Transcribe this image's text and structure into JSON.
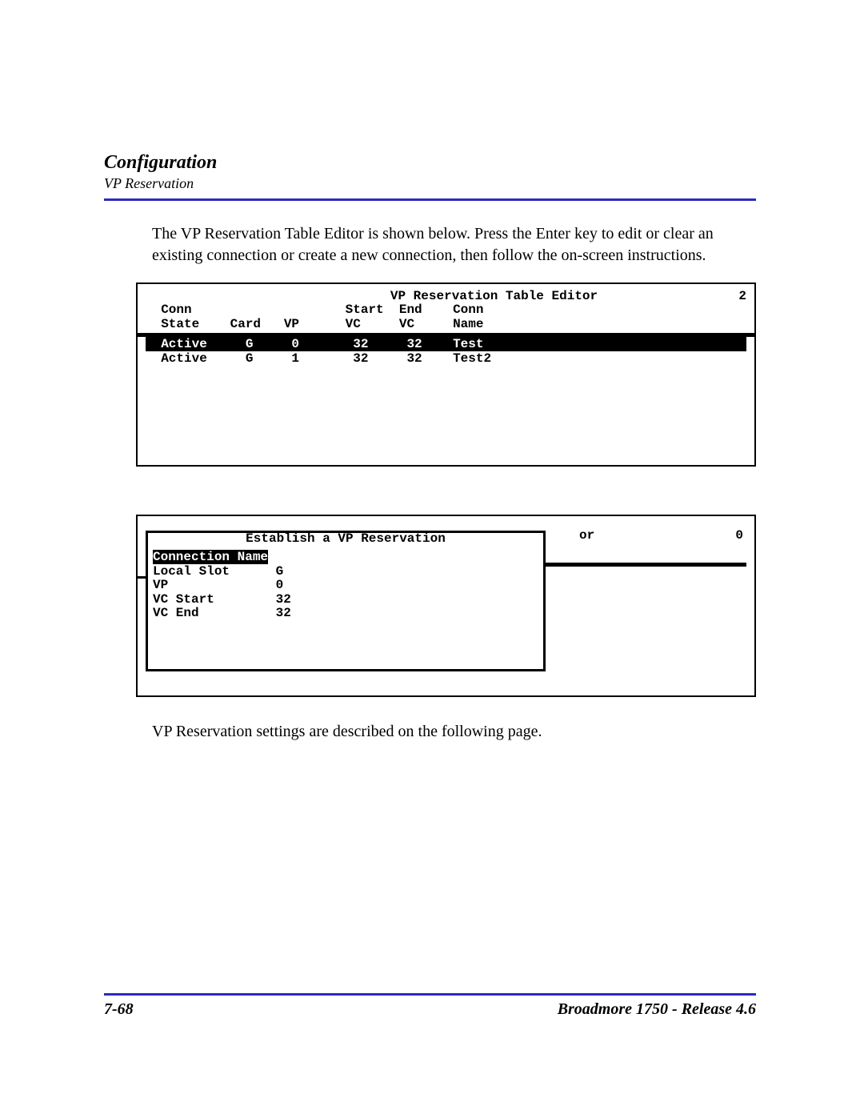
{
  "header": {
    "chapter": "Configuration",
    "section": "VP Reservation"
  },
  "paragraphs": {
    "intro": "The VP Reservation Table Editor is shown below. Press the Enter key to edit or clear an existing connection or create a new connection, then follow the on-screen instructions.",
    "outro": "VP Reservation settings are described on the following page."
  },
  "terminal1": {
    "title": "VP Reservation Table Editor",
    "count": "2",
    "col_header_line1": "  Conn                    Start  End    Conn",
    "col_header_line2": "  State    Card   VP      VC     VC     Name",
    "rows": [
      "  Active     G     0       32     32    Test                       ",
      "  Active     G     1       32     32    Test2"
    ]
  },
  "terminal2": {
    "dialog_title": "Establish a VP Reservation",
    "field_highlight": "Connection Name",
    "fields_rest": "Local Slot      G\nVP              0\nVC Start        32\nVC End          32",
    "right_label": "or",
    "right_num": "0"
  },
  "footer": {
    "page": "7-68",
    "doc": "Broadmore 1750 - Release 4.6"
  }
}
